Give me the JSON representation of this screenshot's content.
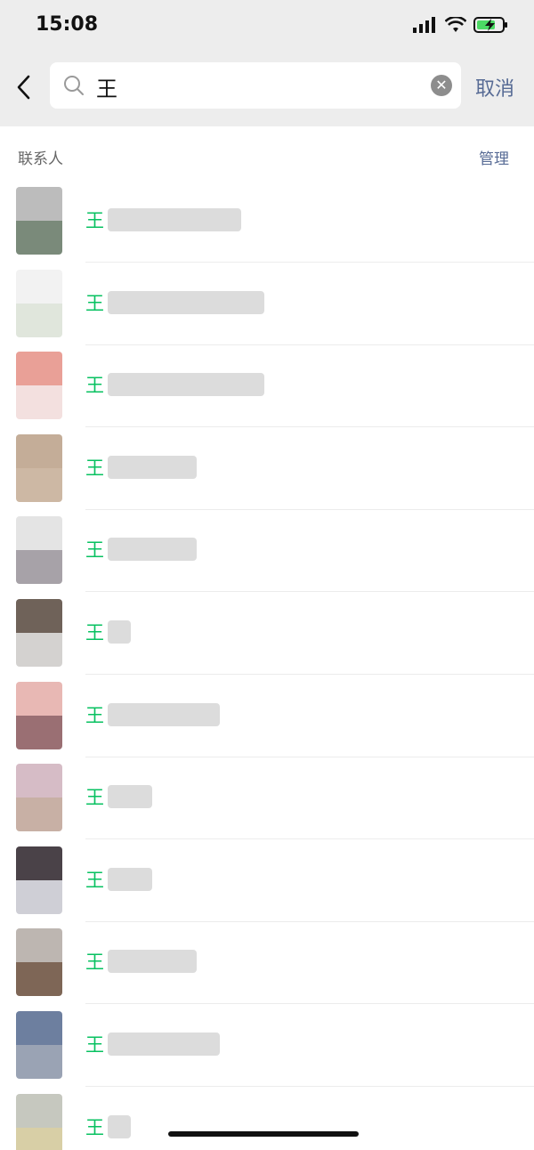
{
  "status": {
    "time": "15:08",
    "icons": [
      "signal-icon",
      "wifi-icon",
      "battery-charging-icon"
    ]
  },
  "search": {
    "back_icon": "chevron-left-icon",
    "search_icon": "magnifier-icon",
    "query": "王",
    "clear_icon": "clear-icon",
    "clear_glyph": "✕",
    "cancel_label": "取消"
  },
  "section": {
    "title": "联系人",
    "manage_label": "管理"
  },
  "contacts": [
    {
      "match": "王",
      "avatar_top": "#bcbcbc",
      "avatar_bottom": "#7a8a7a",
      "blur_width": 150
    },
    {
      "match": "王",
      "avatar_top": "#f2f2f2",
      "avatar_bottom": "#e0e6dc",
      "blur_width": 176
    },
    {
      "match": "王",
      "avatar_top": "#e9a097",
      "avatar_bottom": "#f3e0df",
      "blur_width": 176
    },
    {
      "match": "王",
      "avatar_top": "#c4ad98",
      "avatar_bottom": "#cdb8a4",
      "blur_width": 100
    },
    {
      "match": "王",
      "avatar_top": "#e4e4e4",
      "avatar_bottom": "#a7a2a8",
      "blur_width": 100
    },
    {
      "match": "王",
      "avatar_top": "#6f6259",
      "avatar_bottom": "#d4d2d0",
      "blur_width": 26
    },
    {
      "match": "王",
      "avatar_top": "#e8b8b4",
      "avatar_bottom": "#9a6f73",
      "blur_width": 126
    },
    {
      "match": "王",
      "avatar_top": "#d6bcc6",
      "avatar_bottom": "#c8b0a5",
      "blur_width": 50
    },
    {
      "match": "王",
      "avatar_top": "#4a4248",
      "avatar_bottom": "#cfcfd6",
      "blur_width": 50
    },
    {
      "match": "王",
      "avatar_top": "#bdb6b1",
      "avatar_bottom": "#7e6656",
      "blur_width": 100
    },
    {
      "match": "王",
      "avatar_top": "#6d7f9f",
      "avatar_bottom": "#9aa3b4",
      "blur_width": 126
    },
    {
      "match": "王",
      "avatar_top": "#c6c8bf",
      "avatar_bottom": "#d8cfa6",
      "blur_width": 26
    }
  ]
}
